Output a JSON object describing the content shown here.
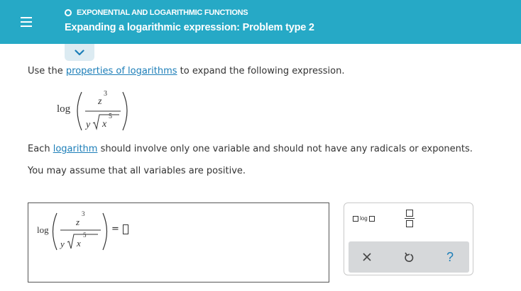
{
  "header": {
    "topic": "EXPONENTIAL AND LOGARITHMIC FUNCTIONS",
    "title": "Expanding a logarithmic expression: Problem type 2"
  },
  "question": {
    "line1_before": "Use the ",
    "line1_link": "properties of logarithms",
    "line1_after": " to expand the following expression.",
    "line2_before": "Each ",
    "line2_link": "logarithm",
    "line2_after": " should involve only one variable and should not have any radicals or exponents.",
    "line3": "You may assume that all variables are positive."
  },
  "expression": {
    "func": "log",
    "numerator_var": "z",
    "numerator_exp": "3",
    "denominator_var_y": "y",
    "radical_var": "x",
    "radical_exp": "5"
  },
  "answer": {
    "equals": "="
  },
  "keypad": {
    "log_label": "log",
    "clear_label": "×",
    "help_label": "?"
  },
  "colors": {
    "header_bg": "#26a9c6",
    "link": "#1c7eb8",
    "keybar_bg": "#d6d8da"
  },
  "icons": {
    "menu": "hamburger-menu-icon",
    "collapse": "chevron-down-icon",
    "undo": "undo-icon",
    "clear": "close-icon",
    "help": "help-icon"
  }
}
